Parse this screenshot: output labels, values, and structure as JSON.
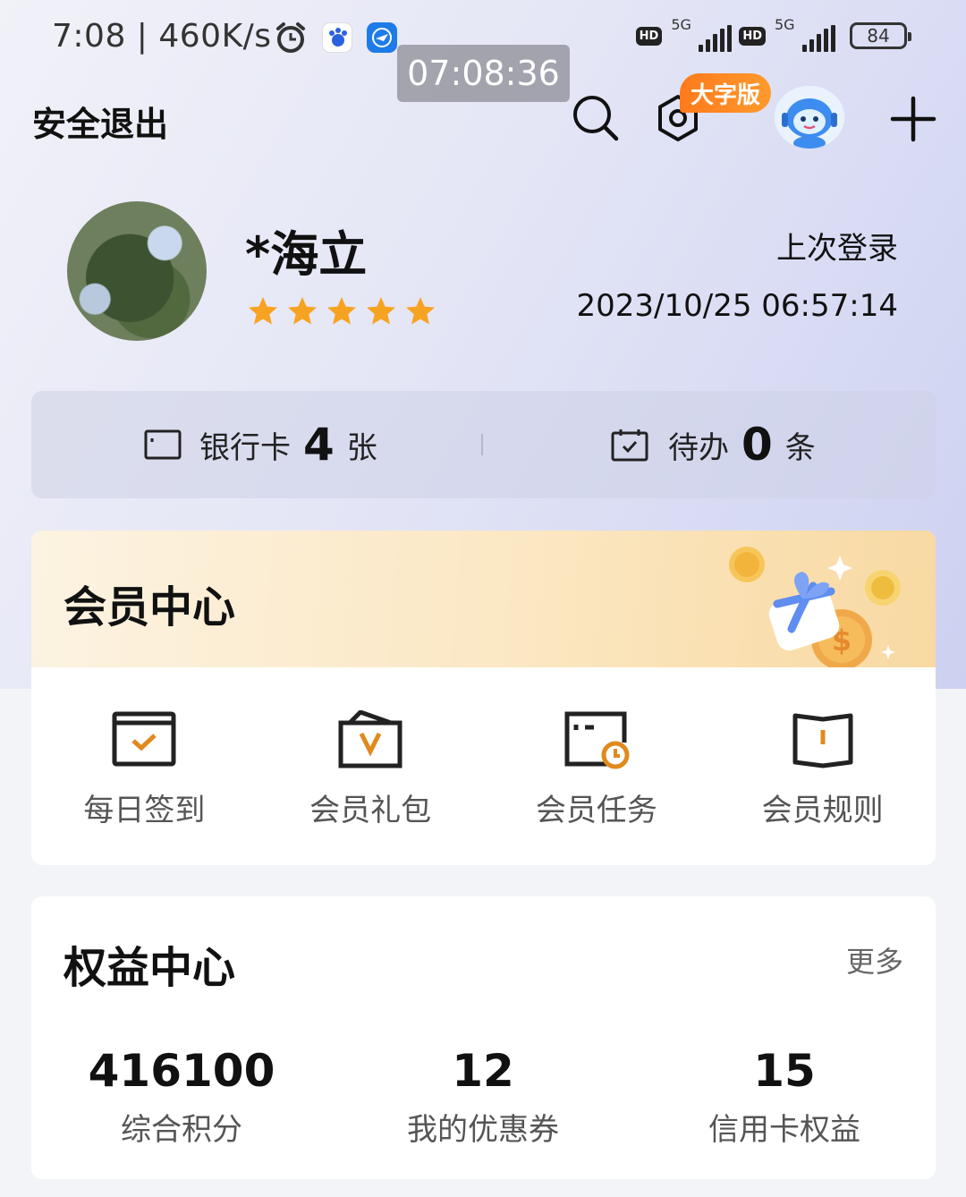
{
  "status_bar": {
    "time": "7:08",
    "net_speed": "460K/s",
    "network_label": "5G",
    "battery": "84"
  },
  "clock_overlay": "07:08:36",
  "header": {
    "logout_label": "安全退出",
    "big_font_label": "大字版"
  },
  "profile": {
    "name": "*海立",
    "star_rating": 5,
    "last_login_label": "上次登录",
    "last_login_time": "2023/10/25 06:57:14"
  },
  "summary": {
    "bank_card_label": "银行卡",
    "bank_card_count": "4",
    "bank_card_unit": "张",
    "todo_label": "待办",
    "todo_count": "0",
    "todo_unit": "条"
  },
  "member_center": {
    "title": "会员中心",
    "items": [
      {
        "label": "每日签到",
        "icon": "calendar-check-icon"
      },
      {
        "label": "会员礼包",
        "icon": "gift-bag-icon"
      },
      {
        "label": "会员任务",
        "icon": "task-clock-icon"
      },
      {
        "label": "会员规则",
        "icon": "rule-book-icon"
      }
    ]
  },
  "rights_center": {
    "title": "权益中心",
    "more_label": "更多",
    "stats": [
      {
        "value": "416100",
        "label": "综合积分"
      },
      {
        "value": "12",
        "label": "我的优惠券"
      },
      {
        "value": "15",
        "label": "信用卡权益"
      }
    ]
  },
  "colors": {
    "accent_orange": "#e08a1e",
    "badge_orange": "#ff7a1a",
    "text_dark": "#111111"
  }
}
